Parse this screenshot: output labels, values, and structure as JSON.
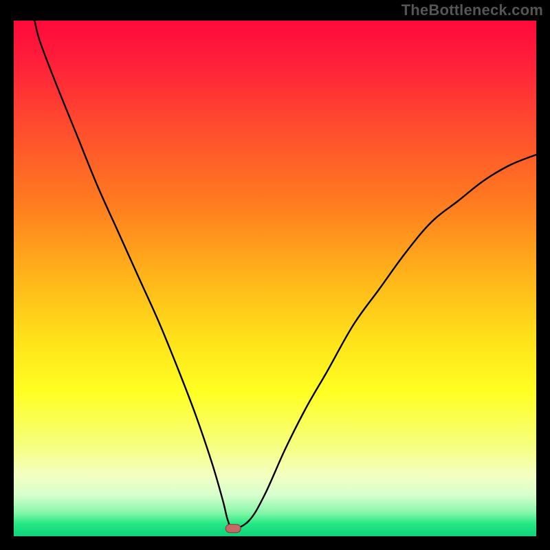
{
  "watermark": "TheBottleneck.com",
  "colors": {
    "frame": "#000000",
    "curve": "#000000",
    "marker_fill": "#c66864",
    "marker_stroke": "#7c3a38",
    "gradient_stops": [
      {
        "offset": 0.0,
        "color": "#ff0a3b"
      },
      {
        "offset": 0.08,
        "color": "#ff1f3a"
      },
      {
        "offset": 0.2,
        "color": "#ff4a2f"
      },
      {
        "offset": 0.35,
        "color": "#ff7a20"
      },
      {
        "offset": 0.5,
        "color": "#ffb61a"
      },
      {
        "offset": 0.62,
        "color": "#ffe21a"
      },
      {
        "offset": 0.72,
        "color": "#ffff22"
      },
      {
        "offset": 0.82,
        "color": "#f6ff7a"
      },
      {
        "offset": 0.88,
        "color": "#f4ffc0"
      },
      {
        "offset": 0.92,
        "color": "#d8ffce"
      },
      {
        "offset": 0.955,
        "color": "#84f7a9"
      },
      {
        "offset": 0.975,
        "color": "#26e884"
      },
      {
        "offset": 1.0,
        "color": "#0fd37b"
      }
    ]
  },
  "chart_data": {
    "type": "line",
    "title": "",
    "xlabel": "",
    "ylabel": "",
    "xlim": [
      0,
      100
    ],
    "ylim": [
      0,
      100
    ],
    "grid": false,
    "legend": false,
    "marker": {
      "x": 42,
      "y": 1.5
    },
    "series": [
      {
        "name": "curve",
        "segment": "left",
        "x": [
          4,
          5,
          8,
          12,
          16,
          20,
          24,
          28,
          32,
          35,
          38,
          40,
          41,
          42
        ],
        "y": [
          100,
          96,
          88,
          78,
          68,
          59,
          50,
          41,
          31,
          23,
          14,
          7,
          3,
          1.5
        ]
      },
      {
        "name": "curve",
        "segment": "right",
        "x": [
          42,
          45,
          48,
          52,
          56,
          60,
          65,
          70,
          75,
          80,
          85,
          90,
          95,
          100
        ],
        "y": [
          1.5,
          3,
          8,
          17,
          25,
          32,
          41,
          48,
          55,
          61,
          65,
          69,
          72,
          74
        ]
      }
    ]
  }
}
